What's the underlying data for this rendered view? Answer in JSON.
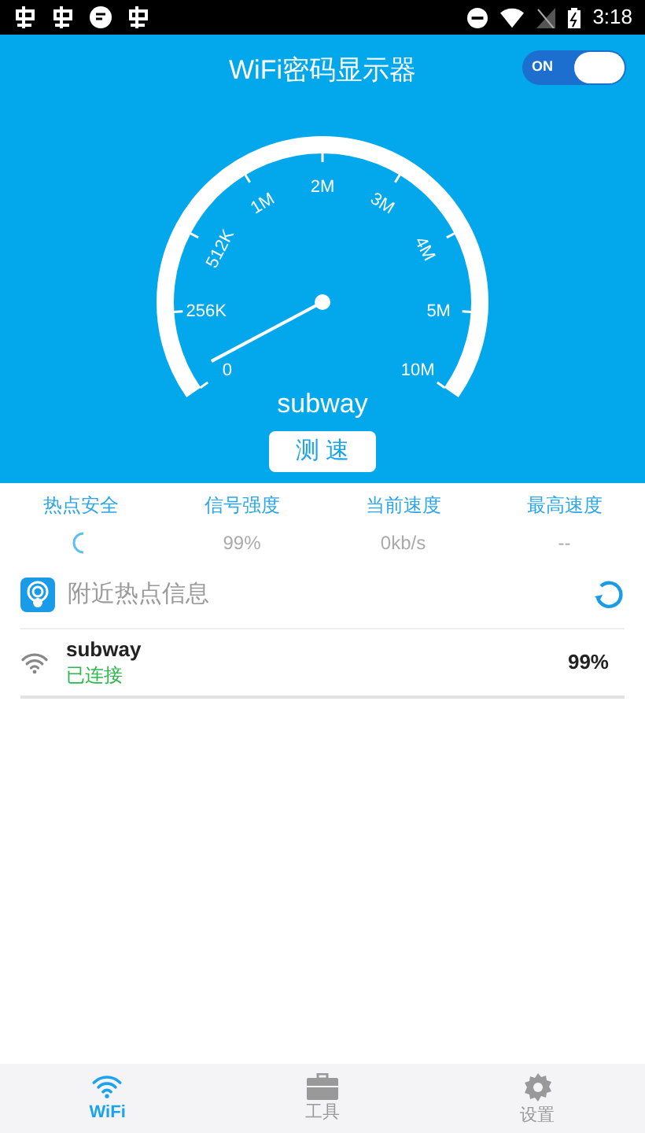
{
  "status_bar": {
    "time": "3:18"
  },
  "header": {
    "title": "WiFi密码显示器",
    "toggle": {
      "label": "ON",
      "on": true
    }
  },
  "gauge": {
    "labels": [
      "0",
      "256K",
      "512K",
      "1M",
      "2M",
      "3M",
      "4M",
      "5M",
      "10M"
    ],
    "network": "subway",
    "button": "测 速"
  },
  "stats": [
    {
      "label": "热点安全",
      "kind": "spinner"
    },
    {
      "label": "信号强度",
      "kind": "text",
      "value": "99%"
    },
    {
      "label": "当前速度",
      "kind": "text",
      "value": "0kb/s"
    },
    {
      "label": "最高速度",
      "kind": "text",
      "value": "--"
    }
  ],
  "nearby": {
    "title": "附近热点信息",
    "networks": [
      {
        "name": "subway",
        "status": "已连接",
        "signal": "99%"
      }
    ]
  },
  "tabs": [
    {
      "label": "WiFi",
      "kind": "wifi",
      "selected": true
    },
    {
      "label": "工具",
      "kind": "toolbox",
      "selected": false
    },
    {
      "label": "设置",
      "kind": "gear",
      "selected": false
    }
  ]
}
